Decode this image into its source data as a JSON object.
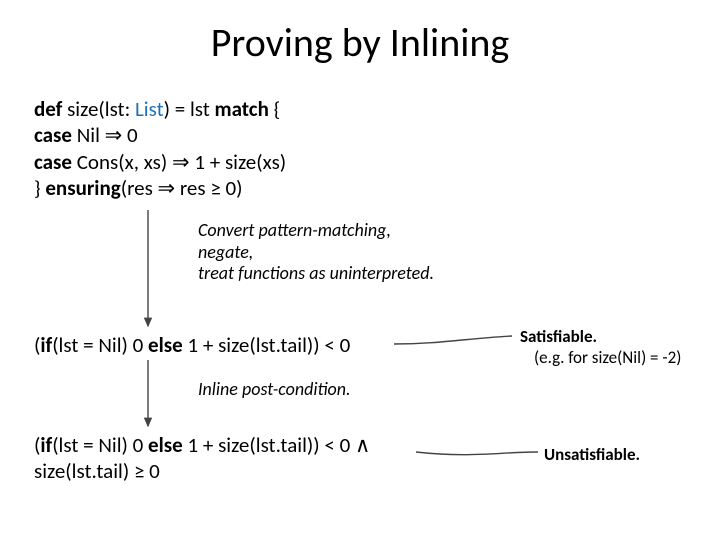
{
  "title": "Proving by Inlining",
  "code": {
    "l1a": "def",
    "l1b": " size(lst: ",
    "l1c": "List",
    "l1d": ") = lst ",
    "l1e": "match",
    "l1f": " {",
    "l2a": "  case",
    "l2b": " Nil ⇒ 0",
    "l3a": "  case",
    "l3b": " Cons(x, xs) ⇒ 1 + size(xs)",
    "l4a": "} ",
    "l4b": "ensuring",
    "l4c": "(res ⇒ res ≥ 0)"
  },
  "annot1": {
    "l1": "Convert pattern-matching,",
    "l2": "negate,",
    "l3": "treat functions as uninterpreted."
  },
  "expr1": {
    "a": "(",
    "b": "if",
    "c": "(lst = Nil) 0 ",
    "d": "else",
    "e": " 1 + size(lst.tail)) < 0"
  },
  "annot2": "Inline post-condition.",
  "expr2": {
    "l1a": "(",
    "l1b": "if",
    "l1c": "(lst = Nil) 0 ",
    "l1d": "else",
    "l1e": " 1 + size(lst.tail)) < 0 ∧",
    "l2": "size(lst.tail) ≥ 0"
  },
  "right1": {
    "l1": "Satisfiable.",
    "l2": "(e.g. for size(Nil) = -2)"
  },
  "right2": "Unsatisfiable."
}
